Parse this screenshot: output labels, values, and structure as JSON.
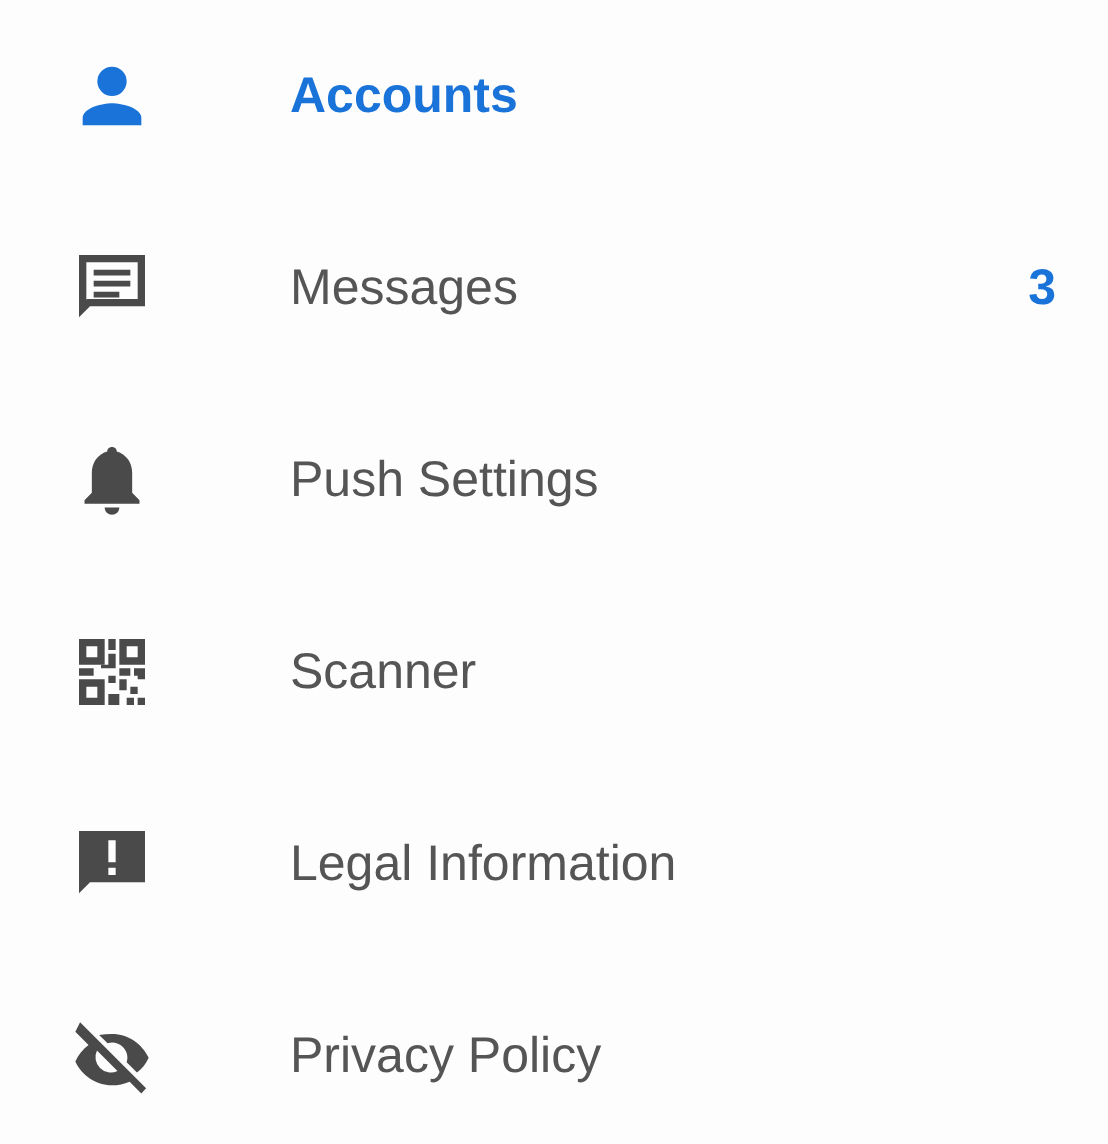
{
  "menu": {
    "items": [
      {
        "label": "Accounts",
        "kind": "person",
        "selected": true
      },
      {
        "label": "Messages",
        "kind": "message",
        "selected": false,
        "count": "3"
      },
      {
        "label": "Push Settings",
        "kind": "bell",
        "selected": false
      },
      {
        "label": "Scanner",
        "kind": "qr",
        "selected": false
      },
      {
        "label": "Legal Information",
        "kind": "alert",
        "selected": false
      },
      {
        "label": "Privacy Policy",
        "kind": "eye-off",
        "selected": false
      }
    ]
  }
}
